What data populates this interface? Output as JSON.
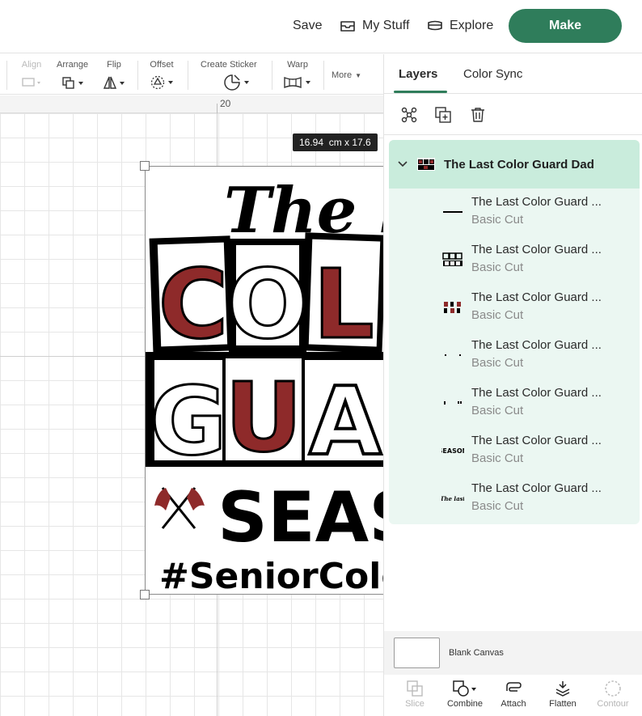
{
  "colors": {
    "accent": "#2f7d5b",
    "group_bg": "#c9ecdc",
    "layer_bg": "#ebf7f2",
    "maroon": "#8e2a2a"
  },
  "header": {
    "save_label": "Save",
    "mystuff_label": "My Stuff",
    "explore_label": "Explore",
    "make_label": "Make"
  },
  "toolbar": {
    "align": "Align",
    "arrange": "Arrange",
    "flip": "Flip",
    "offset": "Offset",
    "create_sticker": "Create Sticker",
    "warp": "Warp",
    "more": "More"
  },
  "canvas": {
    "ruler_value": "20",
    "dimension_badge": "16.94  cm x 17.6",
    "design_lines": [
      "The la",
      "COLO",
      "GUAR",
      "SEAS",
      "#SeniorColorG"
    ]
  },
  "panel": {
    "tabs": [
      "Layers",
      "Color Sync"
    ],
    "group_title": "The Last Color Guard Dad",
    "layers": [
      {
        "name": "The Last Color Guard ...",
        "op": "Basic Cut",
        "thumb": "line-icon"
      },
      {
        "name": "The Last Color Guard ...",
        "op": "Basic Cut",
        "thumb": "boxes-icon"
      },
      {
        "name": "The Last Color Guard ...",
        "op": "Basic Cut",
        "thumb": "red-letters-icon"
      },
      {
        "name": "The Last Color Guard ...",
        "op": "Basic Cut",
        "thumb": "dots-icon"
      },
      {
        "name": "The Last Color Guard ...",
        "op": "Basic Cut",
        "thumb": "marks-icon"
      },
      {
        "name": "The Last Color Guard ...",
        "op": "Basic Cut",
        "thumb": "season-icon",
        "thumb_text": "SEASON"
      },
      {
        "name": "The Last Color Guard ...",
        "op": "Basic Cut",
        "thumb": "script-icon",
        "thumb_text": "The last"
      }
    ],
    "blank_canvas": "Blank Canvas",
    "bottom_tools": [
      "Slice",
      "Combine",
      "Attach",
      "Flatten",
      "Contour"
    ]
  }
}
